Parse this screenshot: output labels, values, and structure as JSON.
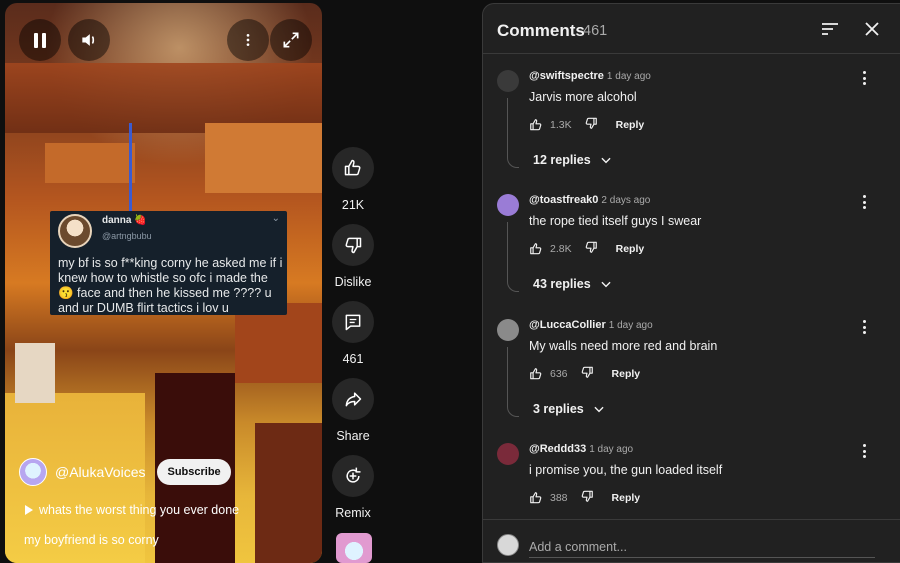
{
  "video": {
    "controls": {
      "pause_icon": "pause-icon",
      "volume_icon": "volume-icon",
      "more_icon": "more-vertical-icon",
      "fullscreen_icon": "fullscreen-icon"
    },
    "tweet": {
      "name": "danna 🍓",
      "handle": "@artngbubu",
      "text": "my bf is so f**king corny he asked me if i knew how to whistle so ofc i made the 😗 face and then he kissed me ???? u and ur DUMB flirt tactics i lov u"
    },
    "channel": "@AlukaVoices",
    "subscribe_label": "Subscribe",
    "caption": "whats the worst thing you ever done",
    "title": "my boyfriend is so corny"
  },
  "rail": {
    "like_count": "21K",
    "dislike_label": "Dislike",
    "comments_count": "461",
    "share_label": "Share",
    "remix_label": "Remix"
  },
  "comments_panel": {
    "title": "Comments",
    "count": "461",
    "add_placeholder": "Add a comment...",
    "comments": [
      {
        "author": "@swiftspectre",
        "time": "1 day ago",
        "text": "Jarvis more alcohol",
        "likes": "1.3K",
        "reply_label": "Reply",
        "replies": "12 replies",
        "avatar_color": "#3a3a3a"
      },
      {
        "author": "@toastfreak0",
        "time": "2 days ago",
        "text": "the rope tied itself guys I swear",
        "likes": "2.8K",
        "reply_label": "Reply",
        "replies": "43 replies",
        "avatar_color": "#9a7cd6"
      },
      {
        "author": "@LuccaCollier",
        "time": "1 day ago",
        "text": "My walls need more red and brain",
        "likes": "636",
        "reply_label": "Reply",
        "replies": "3 replies",
        "avatar_color": "#8a8a8a"
      },
      {
        "author": "@Reddd33",
        "time": "1 day ago",
        "text": "i promise you, the gun loaded itself",
        "likes": "388",
        "reply_label": "Reply",
        "replies": "",
        "avatar_color": "#7a2a3a"
      }
    ]
  }
}
